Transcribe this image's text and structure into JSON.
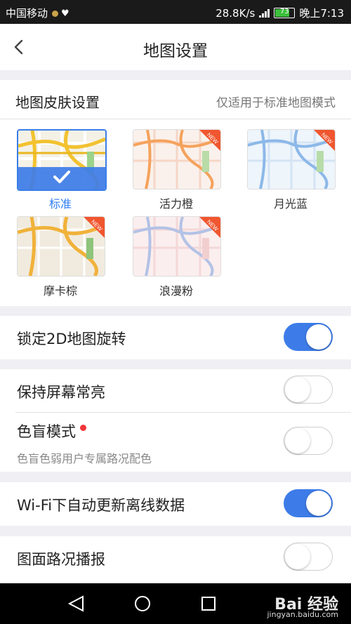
{
  "status_bar": {
    "carrier": "中国移动",
    "net_speed": "28.8K/s",
    "battery": "73",
    "time": "晚上7:13"
  },
  "header": {
    "title": "地图设置"
  },
  "skin_section": {
    "title": "地图皮肤设置",
    "note": "仅适用于标准地图模式",
    "new_badge": "NEW",
    "skins": [
      {
        "label": "标准",
        "selected": true,
        "color": "#f2c230"
      },
      {
        "label": "活力橙",
        "selected": false,
        "color": "#f5a25c",
        "new": true
      },
      {
        "label": "月光蓝",
        "selected": false,
        "color": "#8cb8e8",
        "new": true
      },
      {
        "label": "摩卡棕",
        "selected": false,
        "color": "#f0b23a",
        "new": true
      },
      {
        "label": "浪漫粉",
        "selected": false,
        "color": "#b3c2e6",
        "new": true
      }
    ]
  },
  "settings": {
    "lock_rotation": {
      "label": "锁定2D地图旋转",
      "on": true
    },
    "keep_screen_on": {
      "label": "保持屏幕常亮",
      "on": false
    },
    "color_blind": {
      "label": "色盲模式",
      "sub": "色盲色弱用户专属路况配色",
      "on": false
    },
    "wifi_update": {
      "label": "Wi-Fi下自动更新离线数据",
      "on": true
    },
    "traffic_broadcast": {
      "label": "图面路况播报",
      "on": false
    }
  },
  "nav": {
    "icons": [
      "back-triangle-icon",
      "home-circle-icon",
      "recents-square-icon"
    ]
  },
  "watermark": {
    "text": "Bai 经验",
    "sub": "jingyan.baidu.com"
  },
  "colors": {
    "accent": "#3d7ce8",
    "badge": "#f0562f"
  }
}
